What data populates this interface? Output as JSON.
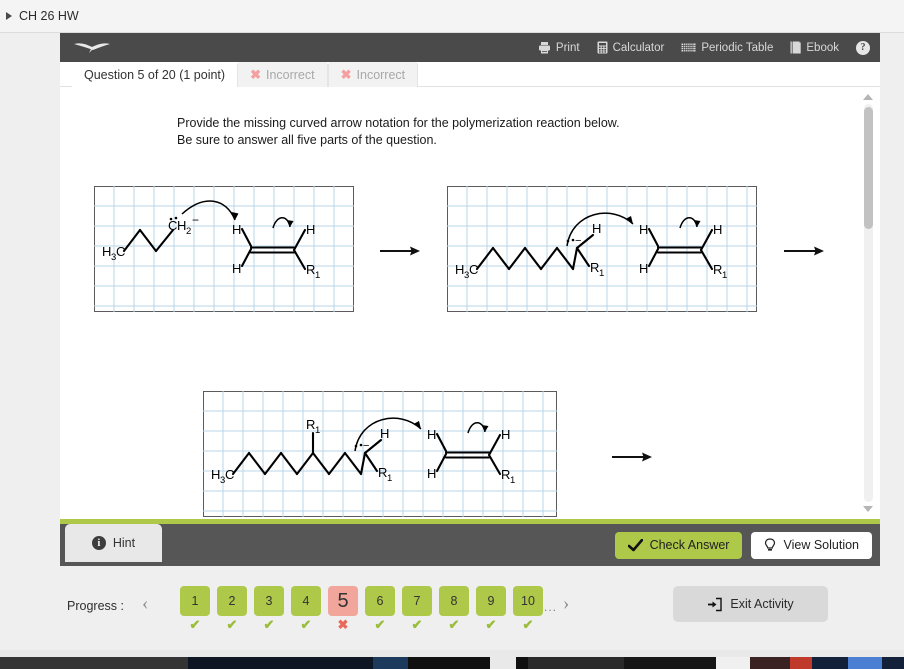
{
  "browser": {
    "bookmark_label": "CH 26 HW",
    "bookmark_icon": "triangle-right-icon"
  },
  "toolbar": {
    "logo_name": "wileyplus-bird-logo",
    "items": [
      {
        "label": "Print",
        "icon": "printer-icon"
      },
      {
        "label": "Calculator",
        "icon": "calculator-icon"
      },
      {
        "label": "Periodic Table",
        "icon": "periodic-table-icon"
      },
      {
        "label": "Ebook",
        "icon": "book-icon"
      }
    ],
    "help_label": "?"
  },
  "tabs": [
    {
      "label": "Question 5 of 20 (1 point)",
      "active": true,
      "icon": null
    },
    {
      "label": "Incorrect",
      "active": false,
      "icon": "x-mark-icon"
    },
    {
      "label": "Incorrect",
      "active": false,
      "icon": "x-mark-icon"
    }
  ],
  "question": {
    "line1": "Provide the missing curved arrow notation for the polymerization reaction below.",
    "line2": "Be sure to answer all five parts of the question."
  },
  "chemistry": {
    "grid_color": "#b9d4ea",
    "bond_color": "#000000",
    "reaction_arrow": "→",
    "diagrams": [
      {
        "name": "step-1-reactants",
        "labels": [
          "H3C",
          "CH2",
          "H",
          "H",
          "H",
          "R1"
        ],
        "charge": "−",
        "lone_pair": "··",
        "curved_arrows": 2
      },
      {
        "name": "step-2-reactants",
        "labels": [
          "H3C",
          "H",
          "R1",
          "H",
          "H",
          "H",
          "R1"
        ],
        "charge": "−",
        "lone_pair": "··",
        "curved_arrows": 2
      },
      {
        "name": "step-3-reactants",
        "labels": [
          "H3C",
          "R1",
          "H",
          "R1",
          "H",
          "H",
          "H",
          "R1"
        ],
        "charge": "−",
        "lone_pair": "··",
        "curved_arrows": 2
      }
    ]
  },
  "actions": {
    "hint_label": "Hint",
    "hint_icon": "info-icon",
    "check_label": "Check Answer",
    "check_icon": "checkmark-icon",
    "solution_label": "View Solution",
    "solution_icon": "lightbulb-icon",
    "check_color": "#aec84a"
  },
  "progress": {
    "label": "Progress :",
    "prev_icon": "chevron-left-icon",
    "next_icon": "chevron-right-icon",
    "ellipsis": "...",
    "current": 5,
    "items": [
      {
        "number": "1",
        "status": "correct"
      },
      {
        "number": "2",
        "status": "correct"
      },
      {
        "number": "3",
        "status": "correct"
      },
      {
        "number": "4",
        "status": "correct"
      },
      {
        "number": "5",
        "status": "incorrect"
      },
      {
        "number": "6",
        "status": "correct"
      },
      {
        "number": "7",
        "status": "correct"
      },
      {
        "number": "8",
        "status": "correct"
      },
      {
        "number": "9",
        "status": "correct"
      },
      {
        "number": "10",
        "status": "correct"
      }
    ],
    "correct_mark": "✔",
    "incorrect_mark": "✖",
    "done_color": "#aec84a",
    "current_color": "#f2a69b"
  },
  "exit": {
    "label": "Exit Activity",
    "icon": "exit-door-icon"
  }
}
